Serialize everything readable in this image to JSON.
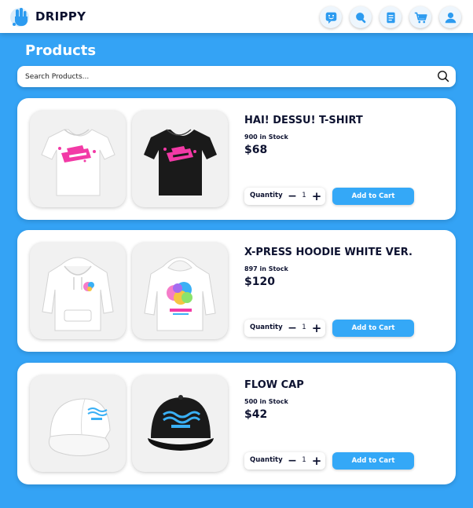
{
  "header": {
    "brand": "DRIPPY",
    "nav": [
      {
        "icon": "chat-icon"
      },
      {
        "icon": "search-icon"
      },
      {
        "icon": "document-icon"
      },
      {
        "icon": "cart-icon"
      },
      {
        "icon": "user-icon"
      }
    ]
  },
  "page_title": "Products",
  "search": {
    "placeholder": "Search Products...",
    "value": ""
  },
  "colors": {
    "background": "#34a3f5",
    "accent": "#34a8f7",
    "text": "#0d1230",
    "icon": "#2c9bf0"
  },
  "products": [
    {
      "name": "HAI! DESSU! T-SHIRT",
      "stock": "900 in Stock",
      "price": "$68",
      "quantity_label": "Quantity",
      "quantity": "1",
      "add_label": "Add to Cart",
      "images": [
        "white-tshirt-image",
        "black-tshirt-image"
      ]
    },
    {
      "name": "X-PRESS HOODIE WHITE VER.",
      "stock": "897 in Stock",
      "price": "$120",
      "quantity_label": "Quantity",
      "quantity": "1",
      "add_label": "Add to Cart",
      "images": [
        "hoodie-front-image",
        "hoodie-back-image"
      ]
    },
    {
      "name": "FLOW CAP",
      "stock": "500 in Stock",
      "price": "$42",
      "quantity_label": "Quantity",
      "quantity": "1",
      "add_label": "Add to Cart",
      "images": [
        "white-cap-image",
        "black-cap-image"
      ]
    }
  ]
}
